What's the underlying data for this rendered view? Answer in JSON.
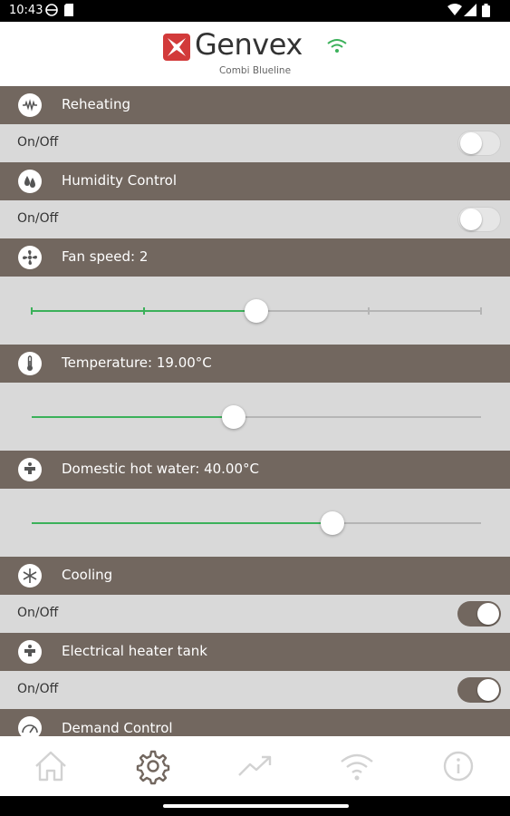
{
  "status_bar": {
    "time": "10:43"
  },
  "header": {
    "brand": "Genvex",
    "model": "Combi Blueline"
  },
  "sections": {
    "reheating": {
      "title": "Reheating",
      "label": "On/Off",
      "state": "off"
    },
    "humidity": {
      "title": "Humidity Control",
      "label": "On/Off",
      "state": "off"
    },
    "fan": {
      "title": "Fan speed: 2",
      "value": 2,
      "steps": 4
    },
    "temperature": {
      "title": "Temperature: 19.00°C",
      "fraction": 0.45
    },
    "hot_water": {
      "title": "Domestic hot water: 40.00°C",
      "fraction": 0.67
    },
    "cooling": {
      "title": "Cooling",
      "label": "On/Off",
      "state": "on"
    },
    "electric_tank": {
      "title": "Electrical heater tank",
      "label": "On/Off",
      "state": "on"
    },
    "demand": {
      "title": "Demand Control"
    }
  },
  "nav": [
    "home-icon",
    "settings-icon",
    "trend-icon",
    "wifi-icon",
    "info-icon"
  ],
  "colors": {
    "header_bg": "#72675f",
    "row_bg": "#d9d9d9",
    "slider_active": "#3bb15a",
    "logo_red": "#d23a3a"
  }
}
